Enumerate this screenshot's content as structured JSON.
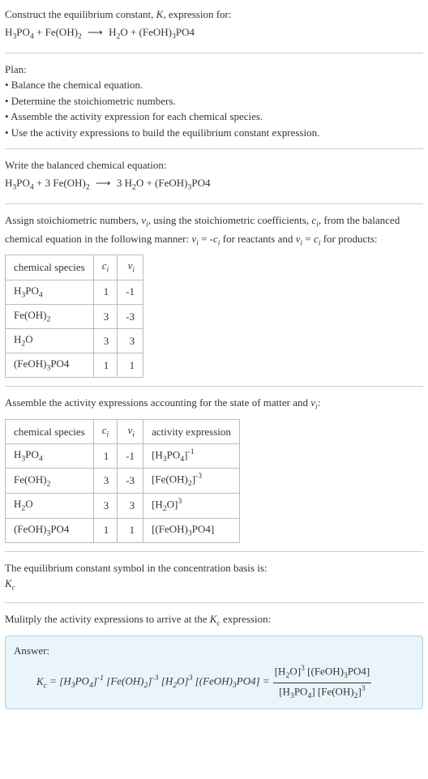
{
  "intro": {
    "title_html": "Construct the equilibrium constant, <span class='ital'>K</span>, expression for:",
    "equation_html": "H<sub>3</sub>PO<sub>4</sub> + Fe(OH)<sub>2</sub> <span class='arrow'>⟶</span> H<sub>2</sub>O + (FeOH)<sub>3</sub>PO4"
  },
  "plan": {
    "heading": "Plan:",
    "items": [
      "• Balance the chemical equation.",
      "• Determine the stoichiometric numbers.",
      "• Assemble the activity expression for each chemical species.",
      "• Use the activity expressions to build the equilibrium constant expression."
    ]
  },
  "balanced": {
    "heading": "Write the balanced chemical equation:",
    "equation_html": "H<sub>3</sub>PO<sub>4</sub> + 3 Fe(OH)<sub>2</sub> <span class='arrow'>⟶</span> 3 H<sub>2</sub>O + (FeOH)<sub>3</sub>PO4"
  },
  "stoich": {
    "intro_html": "Assign stoichiometric numbers, <span class='ital'>ν<sub>i</sub></span>, using the stoichiometric coefficients, <span class='ital'>c<sub>i</sub></span>, from the balanced chemical equation in the following manner: <span class='ital'>ν<sub>i</sub></span> = -<span class='ital'>c<sub>i</sub></span> for reactants and <span class='ital'>ν<sub>i</sub></span> = <span class='ital'>c<sub>i</sub></span> for products:",
    "headers": {
      "species": "chemical species",
      "ci_html": "<span class='ital'>c<sub>i</sub></span>",
      "vi_html": "<span class='ital'>ν<sub>i</sub></span>"
    },
    "rows": [
      {
        "species_html": "H<sub>3</sub>PO<sub>4</sub>",
        "ci": "1",
        "vi": "-1"
      },
      {
        "species_html": "Fe(OH)<sub>2</sub>",
        "ci": "3",
        "vi": "-3"
      },
      {
        "species_html": "H<sub>2</sub>O",
        "ci": "3",
        "vi": "3"
      },
      {
        "species_html": "(FeOH)<sub>3</sub>PO4",
        "ci": "1",
        "vi": "1"
      }
    ]
  },
  "activity": {
    "intro_html": "Assemble the activity expressions accounting for the state of matter and <span class='ital'>ν<sub>i</sub></span>:",
    "headers": {
      "species": "chemical species",
      "ci_html": "<span class='ital'>c<sub>i</sub></span>",
      "vi_html": "<span class='ital'>ν<sub>i</sub></span>",
      "activity": "activity expression"
    },
    "rows": [
      {
        "species_html": "H<sub>3</sub>PO<sub>4</sub>",
        "ci": "1",
        "vi": "-1",
        "activity_html": "[H<sub>3</sub>PO<sub>4</sub>]<sup>-1</sup>"
      },
      {
        "species_html": "Fe(OH)<sub>2</sub>",
        "ci": "3",
        "vi": "-3",
        "activity_html": "[Fe(OH)<sub>2</sub>]<sup>-3</sup>"
      },
      {
        "species_html": "H<sub>2</sub>O",
        "ci": "3",
        "vi": "3",
        "activity_html": "[H<sub>2</sub>O]<sup>3</sup>"
      },
      {
        "species_html": "(FeOH)<sub>3</sub>PO4",
        "ci": "1",
        "vi": "1",
        "activity_html": "[(FeOH)<sub>3</sub>PO4]"
      }
    ]
  },
  "equilibrium_symbol": {
    "text": "The equilibrium constant symbol in the concentration basis is:",
    "symbol_html": "<span class='ital'>K<sub>c</sub></span>"
  },
  "final": {
    "intro_html": "Mulitply the activity expressions to arrive at the <span class='ital'>K<sub>c</sub></span> expression:",
    "answer_label": "Answer:",
    "kc_lhs_html": "<span class='ital'>K<sub>c</sub></span> = [H<sub>3</sub>PO<sub>4</sub>]<sup>-1</sup> [Fe(OH)<sub>2</sub>]<sup>-3</sup> [H<sub>2</sub>O]<sup>3</sup> [(FeOH)<sub>3</sub>PO4] =",
    "frac_num_html": "[H<sub>2</sub>O]<sup>3</sup> [(FeOH)<sub>3</sub>PO4]",
    "frac_den_html": "[H<sub>3</sub>PO<sub>4</sub>] [Fe(OH)<sub>2</sub>]<sup>3</sup>"
  }
}
